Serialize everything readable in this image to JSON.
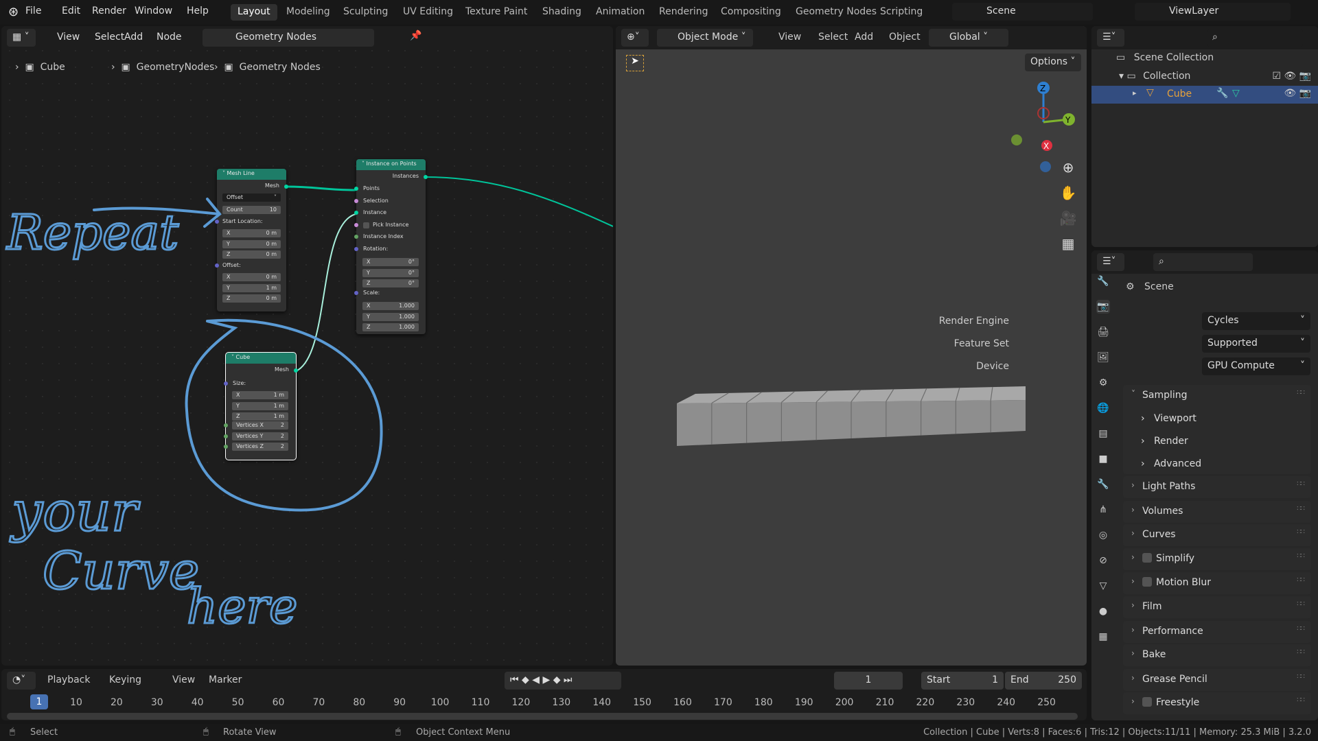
{
  "topbar": {
    "menus": [
      "File",
      "Edit",
      "Render",
      "Window",
      "Help"
    ],
    "workspaces": [
      "Layout",
      "Modeling",
      "Sculpting",
      "UV Editing",
      "Texture Paint",
      "Shading",
      "Animation",
      "Rendering",
      "Compositing",
      "Geometry Nodes",
      "Scripting"
    ],
    "active_workspace": "Layout",
    "scene": "Scene",
    "view_layer": "ViewLayer"
  },
  "node_editor": {
    "menus": [
      "View",
      "Select",
      "Add",
      "Node"
    ],
    "node_tree": "Geometry Nodes",
    "breadcrumb": [
      "Cube",
      "GeometryNodes",
      "Geometry Nodes"
    ],
    "nodes": {
      "mesh_line": {
        "title": "Mesh Line",
        "output": "Mesh",
        "mode": "Offset",
        "count_label": "Count",
        "count": "10",
        "start_label": "Start Location:",
        "start": [
          [
            "X",
            "0 m"
          ],
          [
            "Y",
            "0 m"
          ],
          [
            "Z",
            "0 m"
          ]
        ],
        "offset_label": "Offset:",
        "offset": [
          [
            "X",
            "0 m"
          ],
          [
            "Y",
            "1 m"
          ],
          [
            "Z",
            "0 m"
          ]
        ]
      },
      "instance_on_points": {
        "title": "Instance on Points",
        "output": "Instances",
        "inputs": [
          "Points",
          "Selection",
          "Instance",
          "Pick Instance",
          "Instance Index",
          "Rotation:"
        ],
        "rotation": [
          [
            "X",
            "0°"
          ],
          [
            "Y",
            "0°"
          ],
          [
            "Z",
            "0°"
          ]
        ],
        "scale_label": "Scale:",
        "scale": [
          [
            "X",
            "1.000"
          ],
          [
            "Y",
            "1.000"
          ],
          [
            "Z",
            "1.000"
          ]
        ]
      },
      "cube": {
        "title": "Cube",
        "output": "Mesh",
        "size_label": "Size:",
        "size": [
          [
            "X",
            "1 m"
          ],
          [
            "Y",
            "1 m"
          ],
          [
            "Z",
            "1 m"
          ]
        ],
        "vertices": [
          [
            "Vertices X",
            "2"
          ],
          [
            "Vertices Y",
            "2"
          ],
          [
            "Vertices Z",
            "2"
          ]
        ]
      }
    },
    "annotations": {
      "repeat": "Repeat",
      "your": "your",
      "curve": "Curve",
      "here": "here"
    },
    "annotation_color": "#5b9bd5"
  },
  "viewport": {
    "mode": "Object Mode",
    "menus": [
      "View",
      "Select",
      "Add",
      "Object"
    ],
    "orientation": "Global",
    "options": "Options",
    "gizmo": {
      "x": "X",
      "y": "Y",
      "z": "Z"
    }
  },
  "outliner": {
    "scene_collection": "Scene Collection",
    "collection": "Collection",
    "object": "Cube"
  },
  "properties": {
    "title": "Scene",
    "render_engine_label": "Render Engine",
    "render_engine": "Cycles",
    "feature_set_label": "Feature Set",
    "feature_set": "Supported",
    "device_label": "Device",
    "device": "GPU Compute",
    "panels": [
      "Sampling",
      "Light Paths",
      "Volumes",
      "Curves",
      "Simplify",
      "Motion Blur",
      "Film",
      "Performance",
      "Bake",
      "Grease Pencil",
      "Freestyle"
    ],
    "sampling_sub": [
      "Viewport",
      "Render",
      "Advanced"
    ]
  },
  "timeline": {
    "menus": [
      "Playback",
      "Keying",
      "View",
      "Marker"
    ],
    "current_frame": "1",
    "start_label": "Start",
    "start": "1",
    "end_label": "End",
    "end": "250",
    "ticks": [
      "10",
      "20",
      "30",
      "40",
      "50",
      "60",
      "70",
      "80",
      "90",
      "100",
      "110",
      "120",
      "130",
      "140",
      "150",
      "160",
      "170",
      "180",
      "190",
      "200",
      "210",
      "220",
      "230",
      "240",
      "250"
    ]
  },
  "statusbar": {
    "select": "Select",
    "rotate": "Rotate View",
    "context": "Object Context Menu",
    "stats": "Collection | Cube | Verts:8 | Faces:6 | Tris:12 | Objects:11/11 | Memory: 25.3 MiB | 3.2.0"
  },
  "colors": {
    "accent": "#4772b3",
    "node_header": "#1e7d68",
    "link": "#00d6a3",
    "object_orange": "#e8a23a"
  }
}
